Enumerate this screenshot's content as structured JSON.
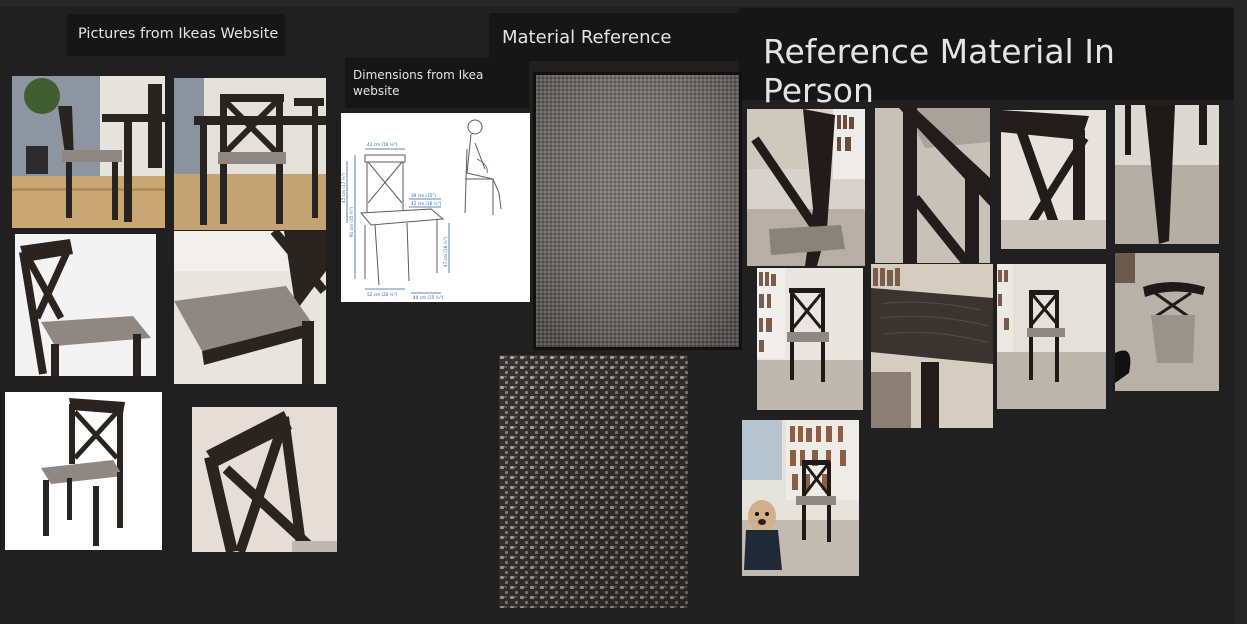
{
  "board": {
    "labels": {
      "ikea_pictures": "Pictures from Ikeas Website",
      "material_reference": "Material Reference",
      "dimensions": "Dimensions from Ikea website",
      "in_person": "Reference Material In Person"
    }
  },
  "dimension_diagram": {
    "top_width": "42 cm (16 ½\")",
    "total_height": "91 cm (35 ¾\")",
    "seat_height": "45 cm (17 ¾\")",
    "seat_width": "39 cm (15\")",
    "seat_depth": "42 cm (16 ½\")",
    "leg_height": "47 cm (18 ½\")",
    "bottom_depth": "52 cm (20 ½\")",
    "bottom_width": "40 cm (15 ¾\")"
  },
  "colors": {
    "background": "#202020",
    "label_bg": "#161616",
    "chair_wood": "#2a2420",
    "seat_fabric": "#8f8882",
    "carpet": "#bdb6ac"
  }
}
